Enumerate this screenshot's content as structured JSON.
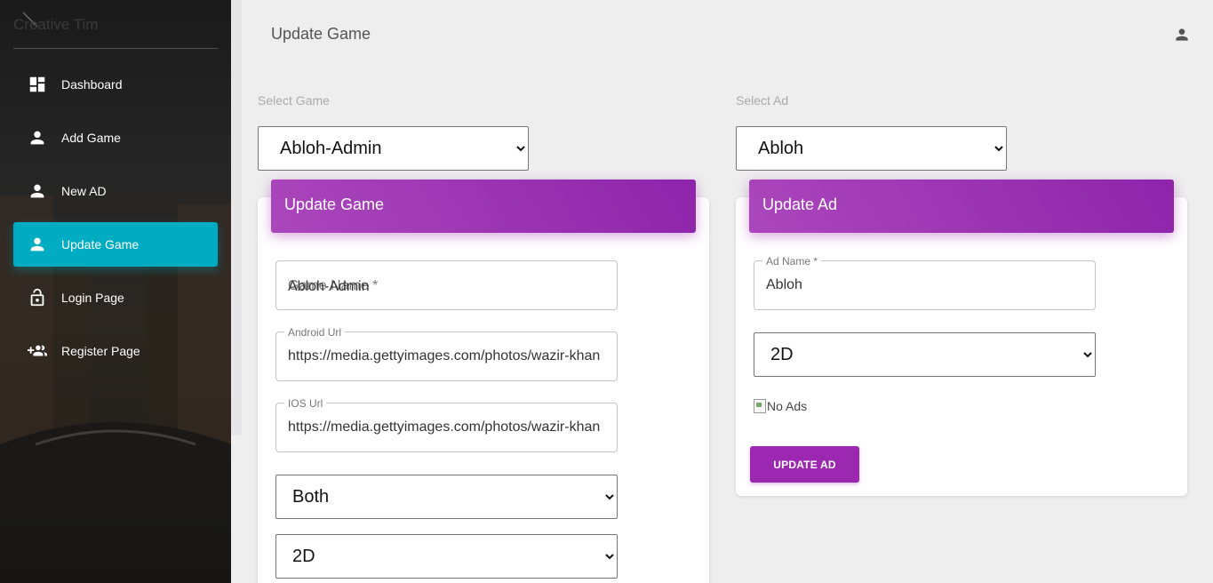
{
  "brand": {
    "name": "Creative Tim"
  },
  "sidebar": {
    "items": [
      {
        "label": "Dashboard",
        "icon": "dashboard-icon",
        "active": false
      },
      {
        "label": "Add Game",
        "icon": "person-icon",
        "active": false
      },
      {
        "label": "New AD",
        "icon": "person-icon",
        "active": false
      },
      {
        "label": "Update Game",
        "icon": "person-icon",
        "active": true
      },
      {
        "label": "Login Page",
        "icon": "lock-icon",
        "active": false
      },
      {
        "label": "Register Page",
        "icon": "group-add-icon",
        "active": false
      }
    ]
  },
  "header": {
    "title": "Update Game",
    "account_icon": "person-icon"
  },
  "select_game": {
    "label": "Select Game",
    "value": "Abloh-Admin"
  },
  "select_ad": {
    "label": "Select Ad",
    "value": "Abloh"
  },
  "game_card": {
    "title": "Update Game",
    "game_name": {
      "label": "Game Name *",
      "value": "Abloh-Admin"
    },
    "android_url": {
      "label": "Android Url",
      "value": "https://media.gettyimages.com/photos/wazir-khan"
    },
    "ios_url": {
      "label": "IOS Url",
      "value": "https://media.gettyimages.com/photos/wazir-khan"
    },
    "platform": {
      "value": "Both"
    },
    "dimension": {
      "value": "2D"
    }
  },
  "ad_card": {
    "title": "Update Ad",
    "ad_name": {
      "label": "Ad Name *",
      "value": "Abloh"
    },
    "dimension": {
      "value": "2D"
    },
    "image_alt": "No Ads",
    "submit_label": "UPDATE AD"
  },
  "colors": {
    "accent": "#9c27b0",
    "active_nav": "#00acc1",
    "background": "#eeeeee"
  }
}
